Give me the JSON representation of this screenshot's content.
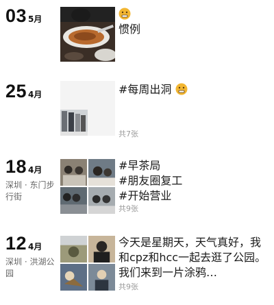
{
  "entries": [
    {
      "day": "03",
      "month": "5月",
      "location": "",
      "text": "惯例",
      "count": ""
    },
    {
      "day": "25",
      "month": "4月",
      "location": "",
      "text": "#每周出洞",
      "count": "共7张"
    },
    {
      "day": "18",
      "month": "4月",
      "location": "深圳 · 东门步行街",
      "text": "#早茶局\n#朋友圈复工\n#开始营业",
      "count": "共9张"
    },
    {
      "day": "12",
      "month": "4月",
      "location": "深圳 · 洪湖公园",
      "text": "今天是星期天，天气真好，我和cpz和hcc一起去逛了公园。我们来到一片涂鸦…",
      "count": "共9张"
    }
  ],
  "icons": {
    "emoji": "grimace-emoji-icon"
  },
  "colors": {
    "text": "#1a1a1a",
    "secondary": "#666666",
    "count": "#9a9a9a",
    "emoji": "#f2b632"
  }
}
